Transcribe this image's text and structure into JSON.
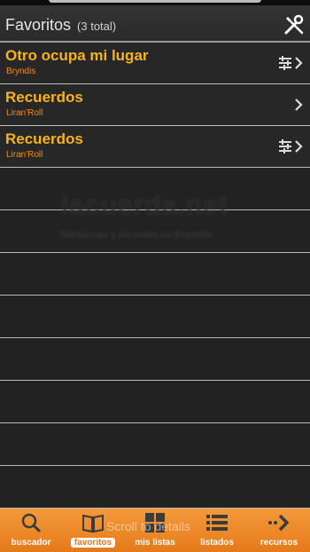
{
  "header": {
    "title": "Favoritos",
    "count": "(3 total)"
  },
  "favorites": [
    {
      "song": "Otro ocupa mi lugar",
      "artist": "Bryndis",
      "has_tune_icon": true
    },
    {
      "song": "Recuerdos",
      "artist": "Liran'Roll",
      "has_tune_icon": false
    },
    {
      "song": "Recuerdos",
      "artist": "Liran'Roll",
      "has_tune_icon": true
    }
  ],
  "watermark": {
    "logo": "lacuerda.net",
    "subtitle": "Tablaturas y Acordes en Español"
  },
  "toast": "Scroll to details",
  "tabs": [
    {
      "label": "buscador",
      "icon": "search-icon"
    },
    {
      "label": "favoritos",
      "icon": "book-icon",
      "active": true
    },
    {
      "label": "mis listas",
      "icon": "grid-icon"
    },
    {
      "label": "listados",
      "icon": "list-icon"
    },
    {
      "label": "recursos",
      "icon": "arrow-icon"
    }
  ],
  "colors": {
    "accent": "#f7b31f",
    "artist": "#f08a1c",
    "bar": "#e57a19"
  }
}
